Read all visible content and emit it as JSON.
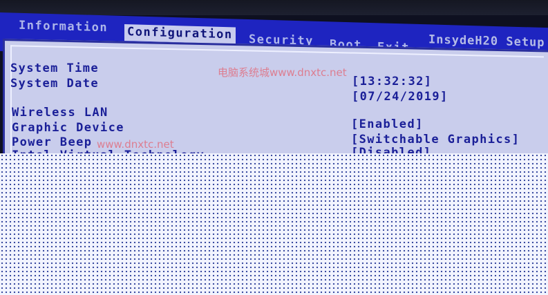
{
  "menu": {
    "tabs": [
      {
        "label": "Information"
      },
      {
        "label": "Configuration"
      },
      {
        "label": "Security"
      },
      {
        "label": "Boot"
      },
      {
        "label": "Exit"
      }
    ],
    "brand": "InsydeH20 Setup",
    "active_tab": "Configuration"
  },
  "settings": [
    {
      "label": "System Time",
      "value": "[13:32:32]"
    },
    {
      "label": "System Date",
      "value": "[07/24/2019]"
    },
    {
      "label": "Wireless LAN",
      "value": "[Enabled]"
    },
    {
      "label": "Graphic Device",
      "value": "[Switchable Graphics]"
    },
    {
      "label": "Power Beep",
      "value": "[Disabled]"
    },
    {
      "label": "Intel Virtual Technology",
      "value": ""
    }
  ],
  "watermarks": {
    "top": "电脑系统城www.dnxtc.net",
    "left": "www.dnxtc.net"
  },
  "colors": {
    "menu_bar": "#1e24c0",
    "panel_bg": "#c9cdec",
    "text": "#1a1f98",
    "watermark": "#ec3c46"
  }
}
